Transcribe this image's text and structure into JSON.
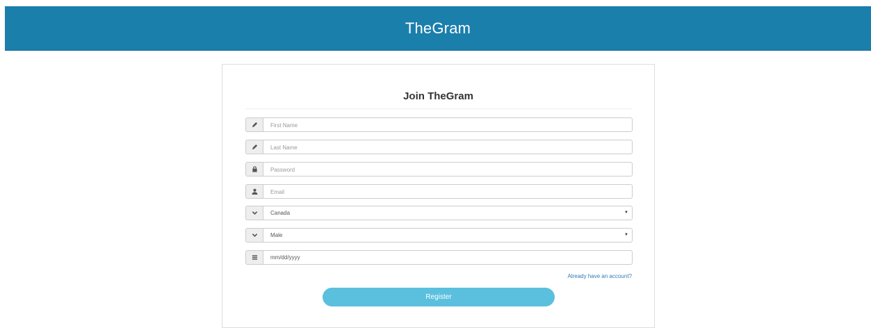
{
  "navbar": {
    "brand": "TheGram"
  },
  "form": {
    "title": "Join TheGram",
    "first_name": {
      "placeholder": "First Name",
      "icon": "pencil-icon"
    },
    "last_name": {
      "placeholder": "Last Name",
      "icon": "pencil-icon"
    },
    "password": {
      "placeholder": "Password",
      "icon": "lock-icon"
    },
    "email": {
      "placeholder": "Email",
      "icon": "user-icon"
    },
    "country": {
      "value": "Canada",
      "icon": "chevron-down-icon"
    },
    "gender": {
      "value": "Male",
      "icon": "chevron-down-icon"
    },
    "birthdate": {
      "value": "mm/dd/yyyy",
      "icon": "list-icon"
    },
    "login_link": "Already have an account?",
    "register_label": "Register"
  },
  "colors": {
    "navbar": "#1b7fac",
    "button": "#5bc0de",
    "link": "#337ab7"
  }
}
